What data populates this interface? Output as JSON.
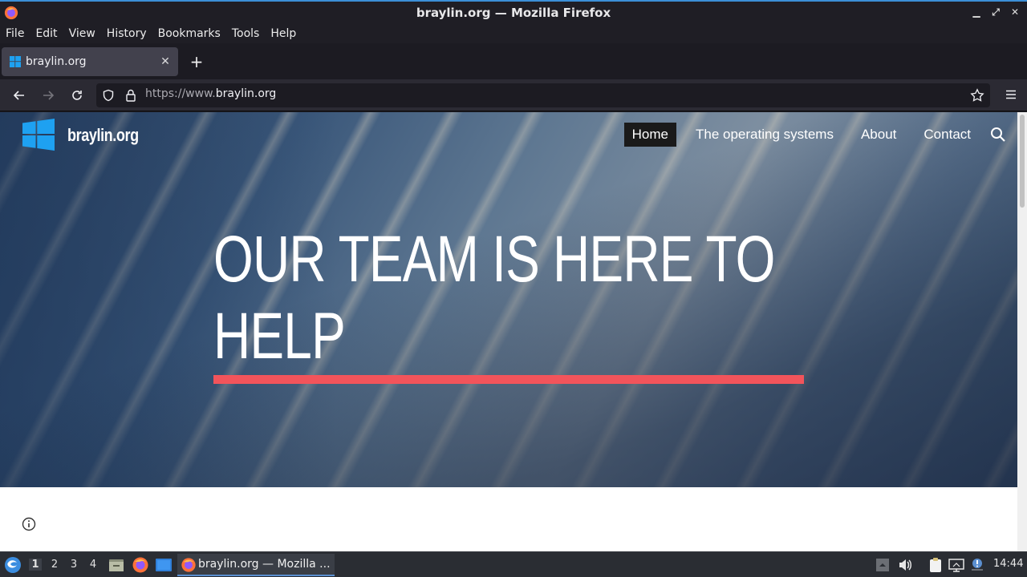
{
  "window": {
    "title": "braylin.org — Mozilla Firefox",
    "controls": [
      "minimize",
      "maximize",
      "close"
    ]
  },
  "menubar": {
    "items": [
      {
        "label": "File"
      },
      {
        "label": "Edit"
      },
      {
        "label": "View"
      },
      {
        "label": "History"
      },
      {
        "label": "Bookmarks"
      },
      {
        "label": "Tools"
      },
      {
        "label": "Help"
      }
    ]
  },
  "tabs": [
    {
      "label": "braylin.org",
      "active": true,
      "icon": "windows-logo-icon"
    }
  ],
  "navbar": {
    "url_prefix": "https://www.",
    "url_domain": "braylin.org"
  },
  "site": {
    "name": "braylin.org",
    "nav": [
      {
        "label": "Home",
        "active": true
      },
      {
        "label": "The operating systems",
        "active": false
      },
      {
        "label": "About",
        "active": false
      },
      {
        "label": "Contact",
        "active": false
      }
    ],
    "hero_title": " OUR TEAM IS HERE TO HELP",
    "accent_color": "#f2545b",
    "logo_color": "#1ea1f1"
  },
  "taskbar": {
    "workspaces": [
      "1",
      "2",
      "3",
      "4"
    ],
    "active_workspace": "1",
    "task_label": "braylin.org — Mozilla ...",
    "clock": "14:44"
  }
}
